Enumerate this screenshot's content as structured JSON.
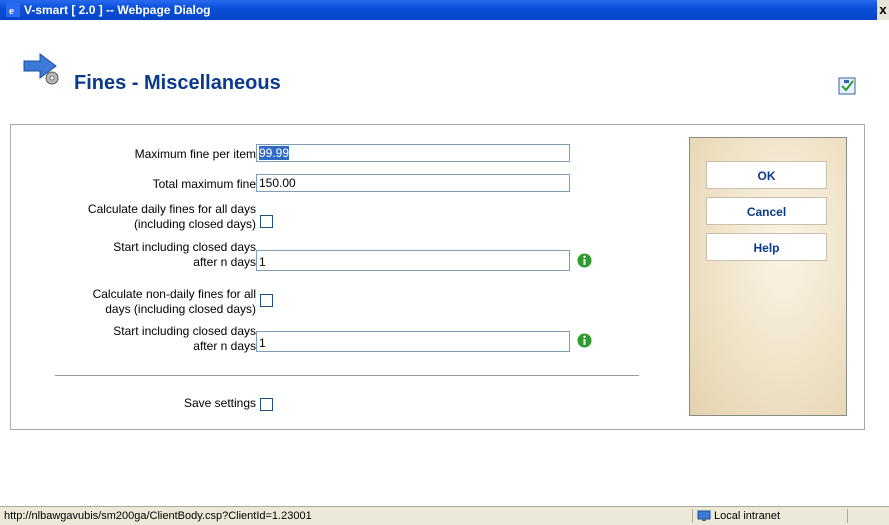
{
  "window": {
    "title": "V-smart [ 2.0 ] -- Webpage Dialog",
    "close_glyph": "x"
  },
  "page": {
    "title": "Fines - Miscellaneous"
  },
  "form": {
    "max_fine_label": "Maximum fine per item",
    "max_fine_value": "99.99",
    "total_max_label": "Total maximum fine",
    "total_max_value": "150.00",
    "daily_all_days_label_1": "Calculate daily fines for all days",
    "daily_all_days_label_2": "(including closed days)",
    "start_closed_1_label_1": "Start including closed days",
    "start_closed_1_label_2": "after n days",
    "start_closed_1_value": "1",
    "nondaily_all_days_label_1": "Calculate non-daily fines for all",
    "nondaily_all_days_label_2": "days (including closed days)",
    "start_closed_2_label_1": "Start including closed days",
    "start_closed_2_label_2": "after n days",
    "start_closed_2_value": "1",
    "save_settings_label": "Save settings"
  },
  "buttons": {
    "ok": "OK",
    "cancel": "Cancel",
    "help": "Help"
  },
  "statusbar": {
    "url": "http://nlbawgavubis/sm200ga/ClientBody.csp?ClientId=1.23001",
    "zone": "Local intranet"
  },
  "colors": {
    "title_text": "#0a3a8c",
    "titlebar": "#0a4fd8",
    "info_green": "#2e9b2e"
  },
  "icons": [
    "ie-app-icon",
    "arrow-gear-icon",
    "help-checklist-icon",
    "info-icon",
    "intranet-zone-icon"
  ]
}
